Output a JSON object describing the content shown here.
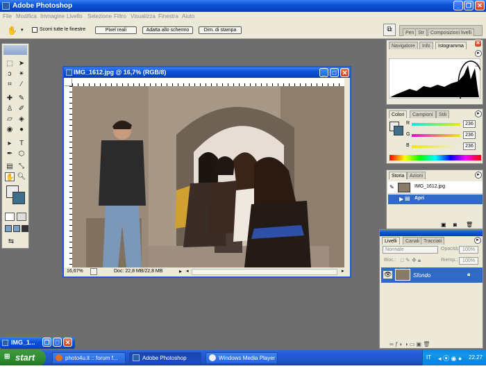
{
  "app": {
    "title": "Adobe Photoshop"
  },
  "menu": [
    "File",
    "Modifica",
    "Immagine",
    "Livello",
    "Selezione",
    "Filtro",
    "Visualizza",
    "Finestra",
    "Aiuto"
  ],
  "options": {
    "scroll_all_label": "Scorri tutte le finestre",
    "actual_pixels": "Pixel reali",
    "fit_screen": "Adatta allo schermo",
    "print_size": "Dim. di stampa",
    "palette_well_tabs": [
      "Pen",
      "Str",
      "Composizioni livelli"
    ]
  },
  "document": {
    "title": "IMG_1612.jpg @ 16,7% (RGB/8)",
    "zoom": "16,67%",
    "doc_info": "Doc: 22,8 MB/22,8 MB"
  },
  "navigator_panel": {
    "tabs": [
      "Navigatore",
      "Info",
      "Istogramma"
    ]
  },
  "color_panel": {
    "tabs": [
      "Colori",
      "Campioni",
      "Stili"
    ],
    "channels": [
      {
        "label": "R",
        "value": "236"
      },
      {
        "label": "G",
        "value": "236"
      },
      {
        "label": "B",
        "value": "236"
      }
    ]
  },
  "history_panel": {
    "tabs": [
      "Storia",
      "Azioni"
    ],
    "snapshot": "IMG_1612.jpg",
    "step": "Apri"
  },
  "layers_panel": {
    "tabs": [
      "Livelli",
      "Canali",
      "Tracciati"
    ],
    "blend_mode": "Normale",
    "opacity_label": "Opacità:",
    "opacity_value": "100%",
    "lock_label": "Bloc.:",
    "fill_label": "Riemp.:",
    "fill_value": "100%",
    "layer_name": "Sfondo"
  },
  "minimized": {
    "title": "IMG_1..."
  },
  "taskbar": {
    "start": "start",
    "tasks": [
      "photo4u.it :: forum f...",
      "Adobe Photoshop",
      "Windows Media Player"
    ],
    "lang": "IT",
    "clock": "22.27"
  },
  "colors": {
    "xp_blue": "#0a53d8",
    "start_green": "#2f8c2f",
    "selection": "#316ac5"
  }
}
